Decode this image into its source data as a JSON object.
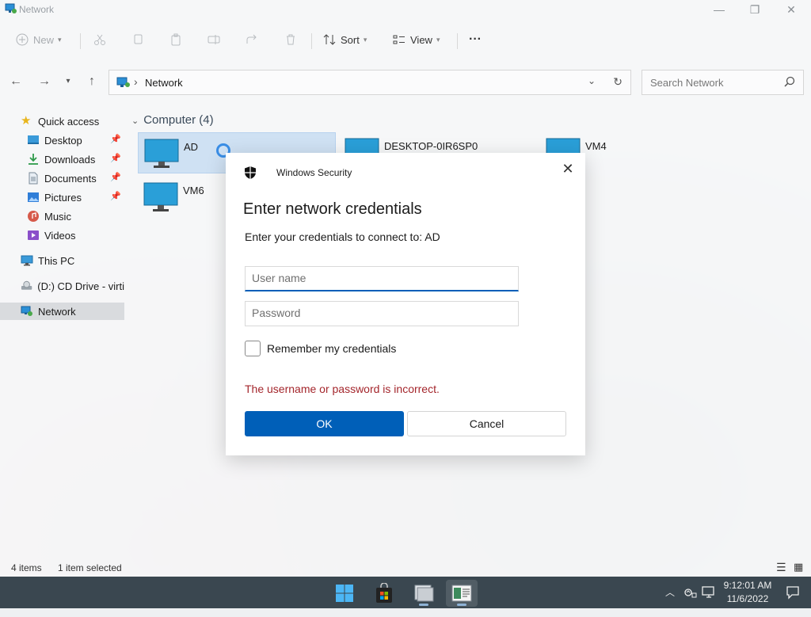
{
  "window": {
    "title": "Network",
    "min_glyph": "—",
    "max_glyph": "❐",
    "close_glyph": "✕"
  },
  "toolbar": {
    "new_label": "New",
    "sort_label": "Sort",
    "view_label": "View",
    "more_glyph": "···"
  },
  "address": {
    "location": "Network",
    "search_placeholder": "Search Network"
  },
  "sidebar": {
    "items": [
      {
        "label": "Quick access"
      },
      {
        "label": "Desktop"
      },
      {
        "label": "Downloads"
      },
      {
        "label": "Documents"
      },
      {
        "label": "Pictures"
      },
      {
        "label": "Music"
      },
      {
        "label": "Videos"
      },
      {
        "label": "This PC"
      },
      {
        "label": "(D:) CD Drive - virti"
      },
      {
        "label": "Network"
      }
    ]
  },
  "content": {
    "group_title": "Computer (4)",
    "computers": [
      "AD",
      "DESKTOP-0IR6SP0",
      "VM4",
      "VM6"
    ]
  },
  "status": {
    "item_count": "4 items",
    "selection": "1 item selected"
  },
  "dialog": {
    "app_name": "Windows Security",
    "heading": "Enter network credentials",
    "subtitle": "Enter your credentials to connect to: AD",
    "username_placeholder": "User name",
    "username_value": "",
    "password_placeholder": "Password",
    "password_value": "",
    "remember_label": "Remember my credentials",
    "remember_checked": false,
    "error": "The username or password is incorrect.",
    "ok_label": "OK",
    "cancel_label": "Cancel",
    "close_glyph": "✕"
  },
  "taskbar": {
    "time": "9:12:01 AM",
    "date": "11/6/2022"
  },
  "colors": {
    "accent": "#005fb8",
    "error": "#a4262c",
    "taskbar": "#3a4750"
  }
}
